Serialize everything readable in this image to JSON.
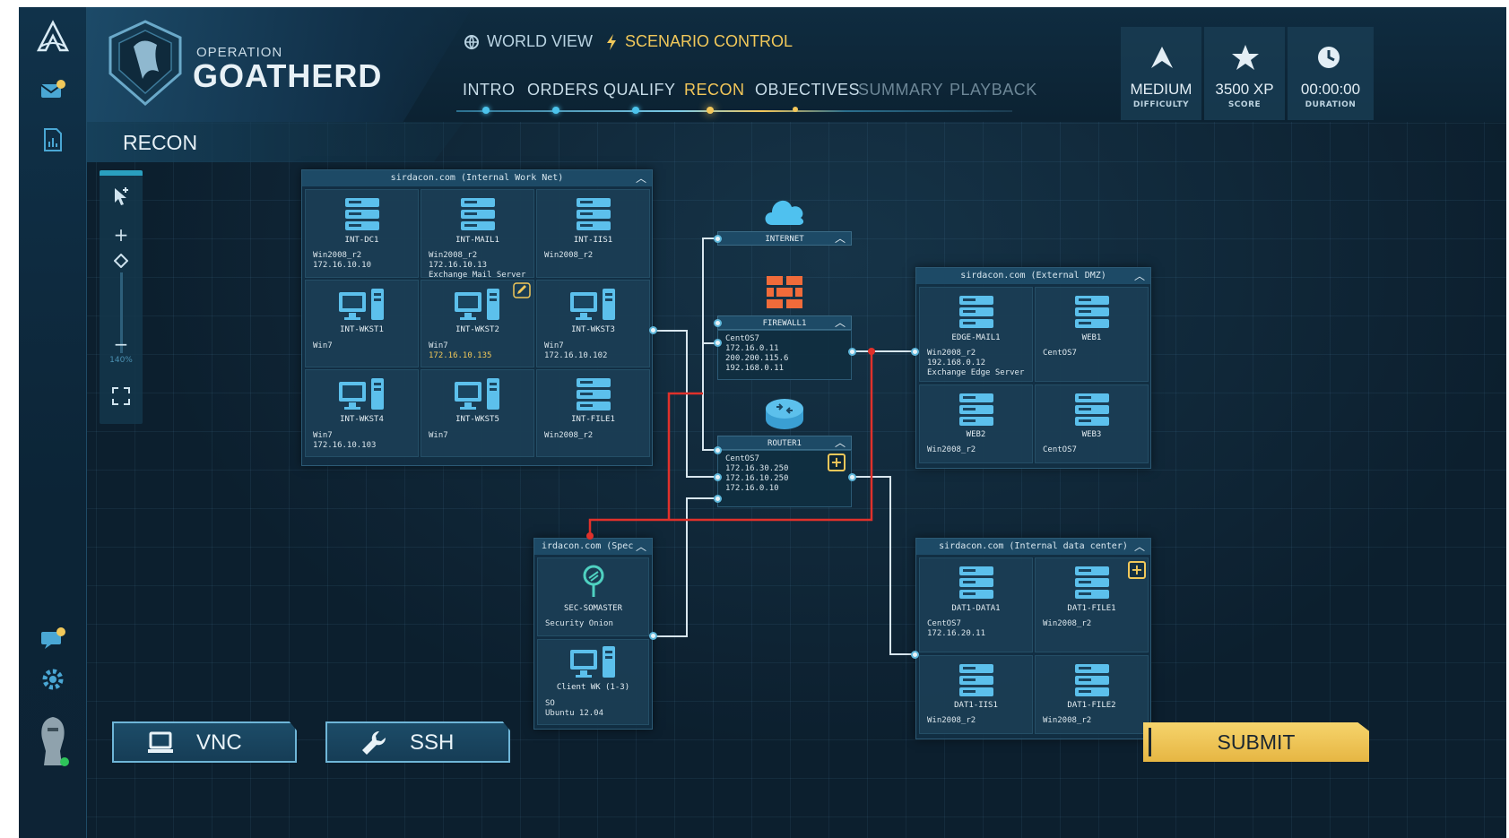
{
  "header": {
    "operation_label": "OPERATION",
    "operation_name": "GOATHERD",
    "top_tabs": [
      {
        "label": "WORLD VIEW",
        "icon": "globe-icon"
      },
      {
        "label": "SCENARIO CONTROL",
        "icon": "lightning-icon"
      }
    ],
    "nav_tabs": [
      {
        "label": "INTRO",
        "state": "done"
      },
      {
        "label": "ORDERS",
        "state": "done"
      },
      {
        "label": "QUALIFY",
        "state": "done"
      },
      {
        "label": "RECON",
        "state": "active"
      },
      {
        "label": "OBJECTIVES",
        "state": "next"
      },
      {
        "label": "SUMMARY",
        "state": "locked"
      },
      {
        "label": "PLAYBACK",
        "state": "locked"
      }
    ],
    "stats": [
      {
        "value": "MEDIUM",
        "label": "DIFFICULTY",
        "icon": "difficulty-icon"
      },
      {
        "value": "3500 XP",
        "label": "SCORE",
        "icon": "star-icon"
      },
      {
        "value": "00:00:00",
        "label": "DURATION",
        "icon": "clock-icon"
      }
    ]
  },
  "page_title": "RECON",
  "zoom": {
    "level": "140%"
  },
  "network": {
    "internal_work_net": {
      "title": "sirdacon.com (Internal Work Net)",
      "hosts": [
        {
          "name": "INT-DC1",
          "type": "server",
          "lines": [
            "Win2008_r2",
            "172.16.10.10"
          ]
        },
        {
          "name": "INT-MAIL1",
          "type": "server",
          "lines": [
            "Win2008_r2",
            "172.16.10.13",
            "Exchange Mail Server"
          ]
        },
        {
          "name": "INT-IIS1",
          "type": "server",
          "lines": [
            "Win2008_r2"
          ]
        },
        {
          "name": "INT-WKST1",
          "type": "workstation",
          "lines": [
            "Win7"
          ]
        },
        {
          "name": "INT-WKST2",
          "type": "workstation",
          "lines": [
            "Win7",
            "172.16.10.135"
          ]
        },
        {
          "name": "INT-WKST3",
          "type": "workstation",
          "lines": [
            "Win7",
            "172.16.10.102"
          ]
        },
        {
          "name": "INT-WKST4",
          "type": "workstation",
          "lines": [
            "Win7",
            "172.16.10.103"
          ]
        },
        {
          "name": "INT-WKST5",
          "type": "workstation",
          "lines": [
            "Win7"
          ]
        },
        {
          "name": "INT-FILE1",
          "type": "server",
          "lines": [
            "Win2008_r2"
          ]
        }
      ]
    },
    "internet": {
      "label": "INTERNET"
    },
    "firewall": {
      "label": "FIREWALL1",
      "lines": "CentOS7\n172.16.0.11\n200.200.115.6\n192.168.0.11"
    },
    "router": {
      "label": "ROUTER1",
      "lines": "CentOS7\n172.16.30.250\n172.16.10.250\n172.16.0.10"
    },
    "external_dmz": {
      "title": "sirdacon.com (External DMZ)",
      "hosts": [
        {
          "name": "EDGE-MAIL1",
          "type": "server",
          "lines": [
            "Win2008_r2",
            "192.168.0.12",
            "Exchange Edge Server"
          ]
        },
        {
          "name": "WEB1",
          "type": "server",
          "lines": [
            "CentOS7"
          ]
        },
        {
          "name": "WEB2",
          "type": "server",
          "lines": [
            "Win2008_r2"
          ]
        },
        {
          "name": "WEB3",
          "type": "server",
          "lines": [
            "CentOS7"
          ]
        }
      ]
    },
    "spec_net": {
      "title": "irdacon.com (Spec",
      "hosts": [
        {
          "name": "SEC-SOMASTER",
          "type": "sensor",
          "lines": [
            "Security Onion"
          ]
        },
        {
          "name": "Client WK (1-3)",
          "type": "workstation",
          "lines": [
            "SO",
            "Ubuntu 12.04"
          ]
        }
      ]
    },
    "data_center": {
      "title": "sirdacon.com (Internal data center)",
      "hosts": [
        {
          "name": "DAT1-DATA1",
          "type": "server",
          "lines": [
            "CentOS7",
            "172.16.20.11"
          ]
        },
        {
          "name": "DAT1-FILE1",
          "type": "server",
          "lines": [
            "Win2008_r2"
          ]
        },
        {
          "name": "DAT1-IIS1",
          "type": "server",
          "lines": [
            "Win2008_r2"
          ]
        },
        {
          "name": "DAT1-FILE2",
          "type": "server",
          "lines": [
            "Win2008_r2"
          ]
        }
      ]
    }
  },
  "buttons": {
    "vnc": "VNC",
    "ssh": "SSH",
    "submit": "SUBMIT"
  },
  "colors": {
    "accent": "#f1c85a",
    "link": "#5fb8dc",
    "alert_path": "#e0312b"
  }
}
